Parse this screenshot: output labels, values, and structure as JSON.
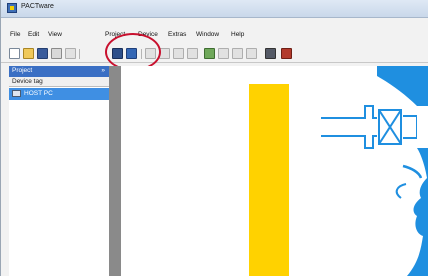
{
  "window": {
    "title": "PACTware"
  },
  "menu": [
    "File",
    "Edit",
    "View",
    "Project",
    "Device",
    "Extras",
    "Window",
    "Help"
  ],
  "toolbar": {
    "buttons": [
      "new-document",
      "open-folder",
      "save",
      "print",
      "device-catalog",
      "connect",
      "project-a",
      "project-b",
      "project-c",
      "project-d",
      "device-add",
      "device-remove",
      "device-up",
      "device-down",
      "report",
      "exit"
    ]
  },
  "project_panel": {
    "title": "Project",
    "pin": "»",
    "column_header": "Device tag",
    "items": [
      {
        "label": "HOST PC",
        "selected": true
      }
    ]
  },
  "colors": {
    "panel_header": "#3a6fc4",
    "selection": "#3f8fe3",
    "highlight_circle": "#c8102e",
    "yellow": "#ffd200",
    "logo_blue": "#1f8fe0"
  }
}
